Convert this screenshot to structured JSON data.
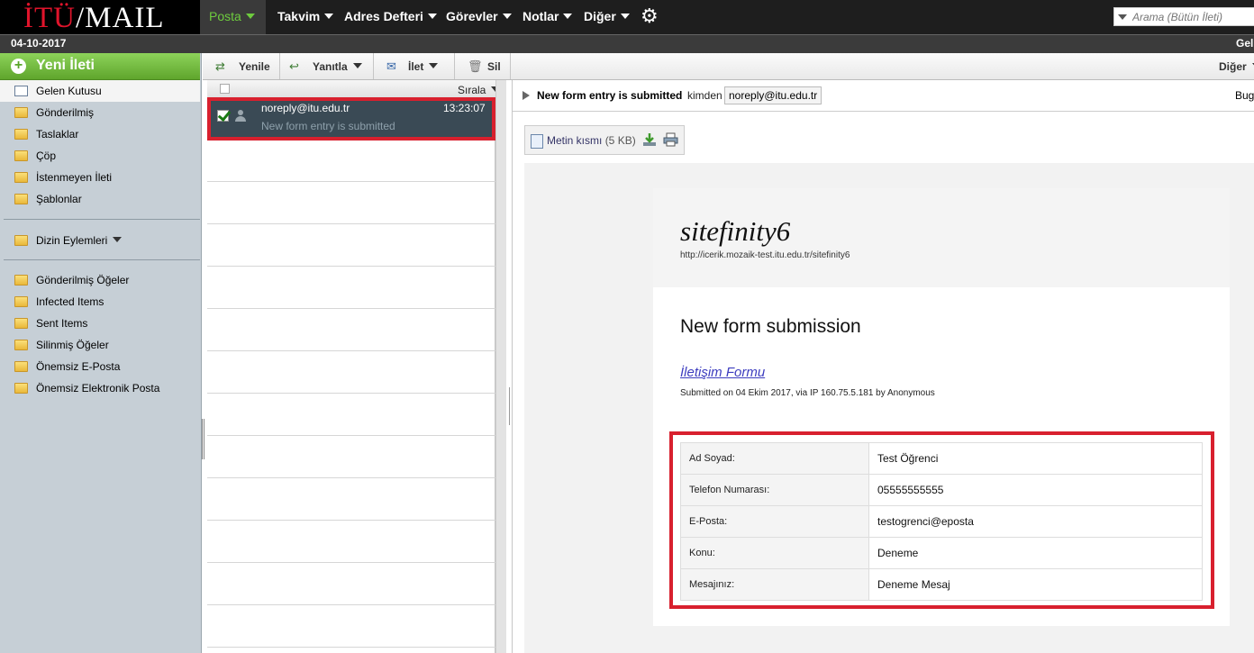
{
  "topnav": {
    "logo_itu": "İTÜ",
    "logo_mail": "/MAIL",
    "items": [
      "Posta",
      "Takvim",
      "Adres Defteri",
      "Görevler",
      "Notlar",
      "Diğer"
    ],
    "search_placeholder": "Arama (Bütün İleti)"
  },
  "datebar": {
    "date": "04-10-2017",
    "right": "Gel"
  },
  "sidebar": {
    "new_message": "Yeni İleti",
    "folders": [
      "Gelen Kutusu",
      "Gönderilmiş",
      "Taslaklar",
      "Çöp",
      "İstenmeyen İleti",
      "Şablonlar"
    ],
    "folder_actions": "Dizin Eylemleri",
    "other_folders": [
      "Gönderilmiş Öğeler",
      "Infected Items",
      "Sent Items",
      "Silinmiş Öğeler",
      "Önemsiz E-Posta",
      "Önemsiz Elektronik Posta"
    ]
  },
  "toolbar": {
    "refresh": "Yenile",
    "reply": "Yanıtla",
    "forward": "İlet",
    "delete": "Sil",
    "more": "Diğer"
  },
  "list": {
    "sort_label": "Sırala",
    "messages": [
      {
        "from": "noreply@itu.edu.tr",
        "time": "13:23:07",
        "subject": "New form entry is submitted"
      }
    ]
  },
  "reader": {
    "subject": "New form entry is submitted",
    "from_label": "kimden",
    "from_address": "noreply@itu.edu.tr",
    "date_truncated": "Bug",
    "attachment": {
      "label": "Metin kısmı",
      "size": "(5 KB)"
    },
    "body": {
      "brand": "sitefinity6",
      "brand_url": "http://icerik.mozaik-test.itu.edu.tr/sitefinity6",
      "title": "New form submission",
      "form_link": "İletişim Formu",
      "meta": "Submitted on 04 Ekim 2017, via IP 160.75.5.181 by Anonymous",
      "fields": [
        {
          "label": "Ad Soyad:",
          "value": "Test Öğrenci"
        },
        {
          "label": "Telefon Numarası:",
          "value": "05555555555"
        },
        {
          "label": "E-Posta:",
          "value": "testogrenci@eposta"
        },
        {
          "label": "Konu:",
          "value": "Deneme"
        },
        {
          "label": "Mesajınız:",
          "value": "Deneme Mesaj"
        }
      ]
    }
  },
  "colors": {
    "accent_green": "#6ecb3e",
    "highlight_red": "#d8202e",
    "selected_row": "#3a4a55"
  }
}
